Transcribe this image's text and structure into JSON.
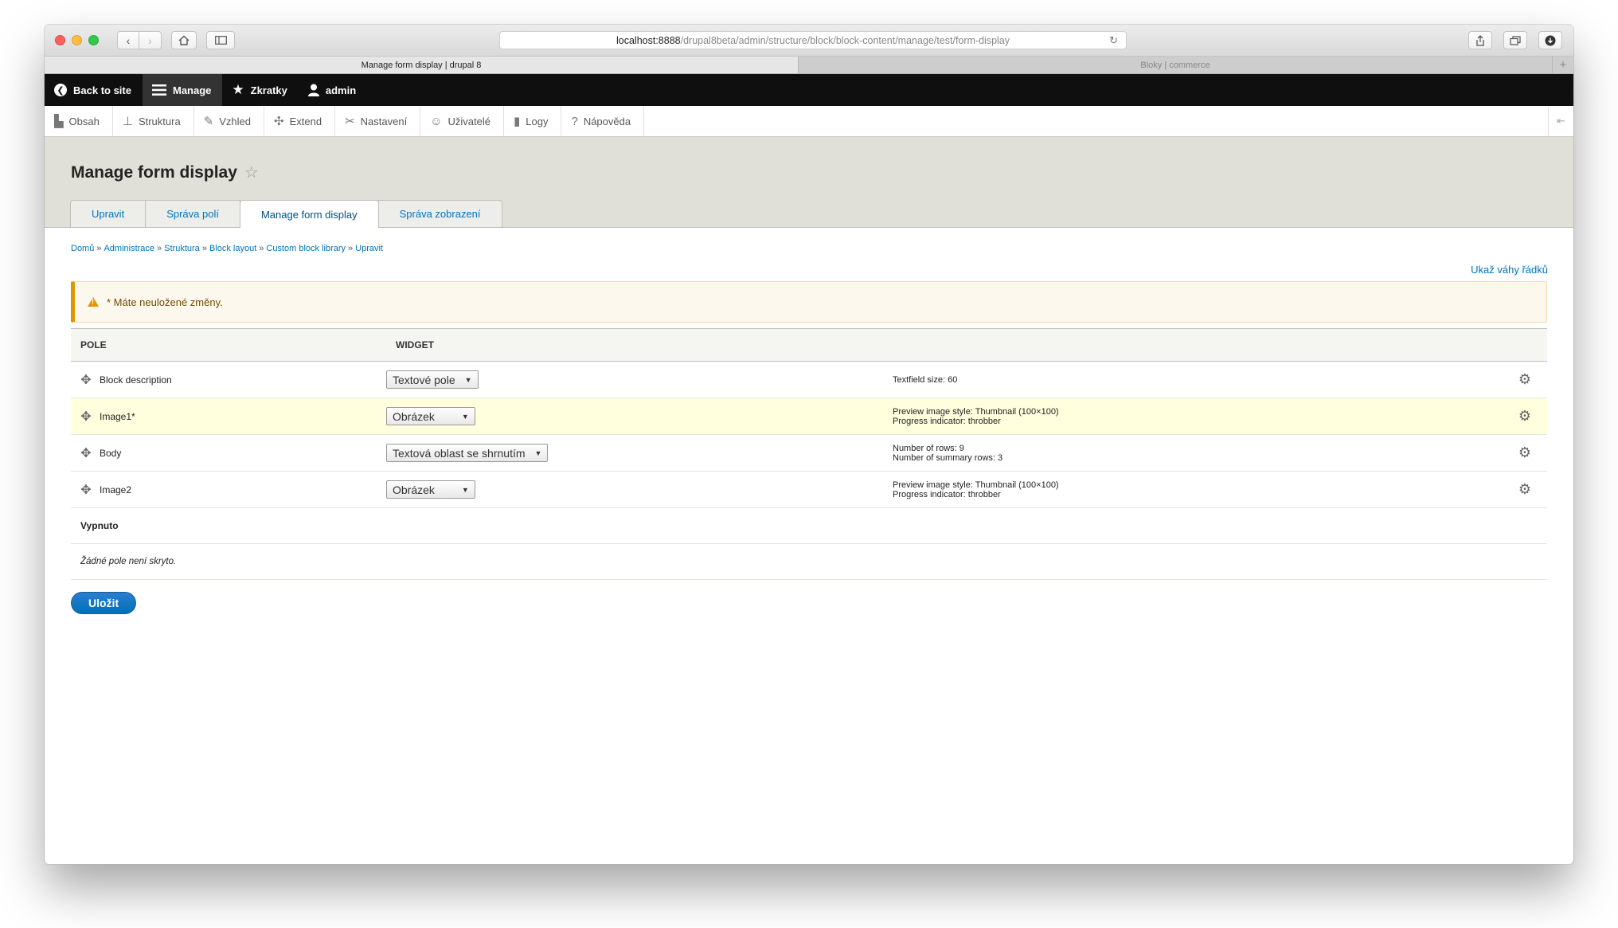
{
  "browser": {
    "url_host": "localhost:8888",
    "url_path": "/drupal8beta/admin/structure/block/block-content/manage/test/form-display",
    "tabs": [
      {
        "label": "Manage form display | drupal 8"
      },
      {
        "label": "Bloky | commerce"
      }
    ],
    "add_tab": "+"
  },
  "toolbar": {
    "back_to_site": "Back to site",
    "manage": "Manage",
    "shortcuts": "Zkratky",
    "user": "admin"
  },
  "tray": {
    "items": [
      {
        "label": "Obsah",
        "icon": "document-icon"
      },
      {
        "label": "Struktura",
        "icon": "structure-icon"
      },
      {
        "label": "Vzhled",
        "icon": "brush-icon"
      },
      {
        "label": "Extend",
        "icon": "puzzle-icon"
      },
      {
        "label": "Nastavení",
        "icon": "wrench-icon"
      },
      {
        "label": "Uživatelé",
        "icon": "people-icon"
      },
      {
        "label": "Logy",
        "icon": "bar-chart-icon"
      },
      {
        "label": "Nápověda",
        "icon": "help-icon"
      }
    ]
  },
  "page": {
    "title": "Manage form display",
    "tabs": [
      {
        "label": "Upravit",
        "active": false
      },
      {
        "label": "Správa polí",
        "active": false
      },
      {
        "label": "Manage form display",
        "active": true
      },
      {
        "label": "Správa zobrazení",
        "active": false
      }
    ],
    "breadcrumb": [
      {
        "label": "Domů"
      },
      {
        "label": "Administrace"
      },
      {
        "label": "Struktura"
      },
      {
        "label": "Block layout"
      },
      {
        "label": "Custom block library"
      },
      {
        "label": "Upravit"
      }
    ],
    "breadcrumb_sep": "»",
    "show_weights": "Ukaž váhy řádků",
    "warning": "* Máte neuložené změny."
  },
  "table": {
    "headers": {
      "field": "POLE",
      "widget": "WIDGET"
    },
    "rows": [
      {
        "field": "Block description",
        "widget": "Textové pole",
        "summary": [
          "Textfield size: 60"
        ],
        "changed": false
      },
      {
        "field": "Image1*",
        "widget": "Obrázek",
        "summary": [
          "Preview image style: Thumbnail (100×100)",
          "Progress indicator: throbber"
        ],
        "changed": true
      },
      {
        "field": "Body",
        "widget": "Textová oblast se shrnutím",
        "summary": [
          "Number of rows: 9",
          "Number of summary rows: 3"
        ],
        "changed": false
      },
      {
        "field": "Image2",
        "widget": "Obrázek",
        "summary": [
          "Preview image style: Thumbnail (100×100)",
          "Progress indicator: throbber"
        ],
        "changed": false
      }
    ],
    "disabled_region": "Vypnuto",
    "empty_text": "Žádné pole není skryto."
  },
  "actions": {
    "save": "Uložit"
  },
  "colors": {
    "link": "#0074bd",
    "warning_border": "#e09600",
    "changed_row": "#ffffdd",
    "button": "#0071b8"
  }
}
